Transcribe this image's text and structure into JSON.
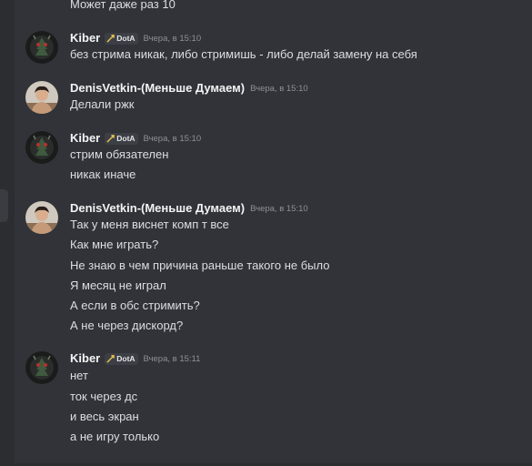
{
  "messages": [
    {
      "type": "text",
      "text": "Может даже раз 10"
    },
    {
      "type": "header",
      "user": "Kiber",
      "tag": "DotA",
      "time": "Вчера, в 15:10"
    },
    {
      "type": "text",
      "text": "без стрима никак, либо стримишь - либо делай замену на себя"
    },
    {
      "type": "header",
      "user": "DenisVetkin-(Меньше Думаем)",
      "tag": "",
      "time": "Вчера, в 15:10"
    },
    {
      "type": "text",
      "text": "Делали ржк"
    },
    {
      "type": "header",
      "user": "Kiber",
      "tag": "DotA",
      "time": "Вчера, в 15:10"
    },
    {
      "type": "text",
      "text": "стрим обязателен"
    },
    {
      "type": "text",
      "text": "никак иначе"
    },
    {
      "type": "header",
      "user": "DenisVetkin-(Меньше Думаем)",
      "tag": "",
      "time": "Вчера, в 15:10"
    },
    {
      "type": "text",
      "text": "Так у меня виснет комп т все"
    },
    {
      "type": "text",
      "text": "Как мне играть?"
    },
    {
      "type": "text",
      "text": "Не знаю в чем причина раньше такого не было"
    },
    {
      "type": "text",
      "text": "Я месяц не играл"
    },
    {
      "type": "text",
      "text": "А если в обс стримить?"
    },
    {
      "type": "text",
      "text": "А не через дискорд?"
    },
    {
      "type": "header",
      "user": "Kiber",
      "tag": "DotA",
      "time": "Вчера, в 15:11"
    },
    {
      "type": "text",
      "text": "нет"
    },
    {
      "type": "text",
      "text": "ток через дс"
    },
    {
      "type": "text",
      "text": "и весь экран"
    },
    {
      "type": "text",
      "text": "а не игру только"
    }
  ]
}
